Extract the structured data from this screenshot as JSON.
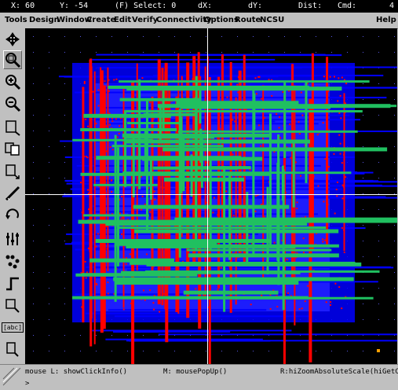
{
  "status": {
    "x": "X: 60",
    "y": "Y: -54",
    "select": "(F) Select: 0",
    "dx": "dX:",
    "dy": "dY:",
    "dist": "Dist:",
    "cmd": "Cmd:",
    "count": "4"
  },
  "menu": [
    "Tools",
    "Design",
    "Window",
    "Create",
    "Edit",
    "Verify",
    "Connectivity",
    "Options",
    "Route",
    "NCSU",
    "Help"
  ],
  "toolbar": [
    "pointer-icon",
    "zoom-fit-icon",
    "zoom-in-icon",
    "zoom-out-icon",
    "stretch-icon",
    "copy-icon",
    "move-icon",
    "ruler-icon",
    "undo-icon",
    "property-icon",
    "hierarchy-icon",
    "path-icon",
    "instance-icon",
    "label-icon",
    "pin-icon"
  ],
  "toolbar_label_text": "[abc]",
  "hints": {
    "left": "mouse L: showClickInfo()",
    "middle": "M: mousePopUp()",
    "right": "R:hiZoomAbsoluteScale(hiGetCu"
  },
  "prompt": ">",
  "colors": {
    "background": "#000000",
    "metal1": "#0000ff",
    "metal2": "#ff0000",
    "metal3": "#20c060",
    "grid": "#6060ff",
    "crosshair": "#ffffff"
  }
}
